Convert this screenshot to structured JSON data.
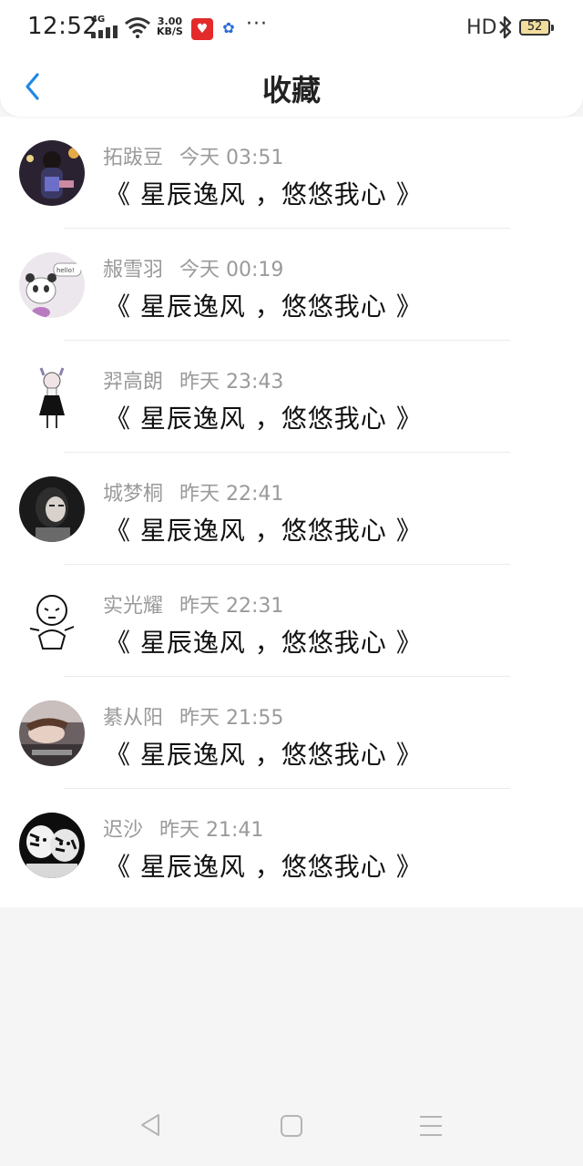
{
  "status_bar": {
    "time": "12:52",
    "network": "4G",
    "speed_top": "3.00",
    "speed_bottom": "KB/S",
    "more": "···",
    "hd": "HD",
    "battery": "52"
  },
  "header": {
    "back_icon": "chevron-left-icon",
    "title": "收藏"
  },
  "colors": {
    "accent": "#1e88e5",
    "meta_gray": "#9a9a9a",
    "divider": "#eceaec"
  },
  "items": [
    {
      "name": "拓跋豆",
      "time": "今天 03:51",
      "message": "《 星辰逸风 ，悠悠我心 》",
      "avatar": "avatar-photo-girl-night"
    },
    {
      "name": "赧雪羽",
      "time": "今天 00:19",
      "message": "《 星辰逸风 ，悠悠我心 》",
      "avatar": "avatar-panda-hello"
    },
    {
      "name": "羿高朗",
      "time": "昨天 23:43",
      "message": "《 星辰逸风 ，悠悠我心 》",
      "avatar": "avatar-anime-girl"
    },
    {
      "name": "城梦桐",
      "time": "昨天 22:41",
      "message": "《 星辰逸风 ，悠悠我心 》",
      "avatar": "avatar-photo-girl-dark"
    },
    {
      "name": "实光耀",
      "time": "昨天 22:31",
      "message": "《 星辰逸风 ，悠悠我心 》",
      "avatar": "avatar-cartoon-baby"
    },
    {
      "name": "綦从阳",
      "time": "昨天 21:55",
      "message": "《 星辰逸风 ，悠悠我心 》",
      "avatar": "avatar-photo-girl-lying"
    },
    {
      "name": "迟沙",
      "time": "昨天 21:41",
      "message": "《 星辰逸风 ，悠悠我心 》",
      "avatar": "avatar-tiger-bw"
    }
  ],
  "nav_bar": {
    "back_icon": "triangle-back-icon",
    "home_icon": "square-home-icon",
    "menu_icon": "menu-lines-icon"
  }
}
